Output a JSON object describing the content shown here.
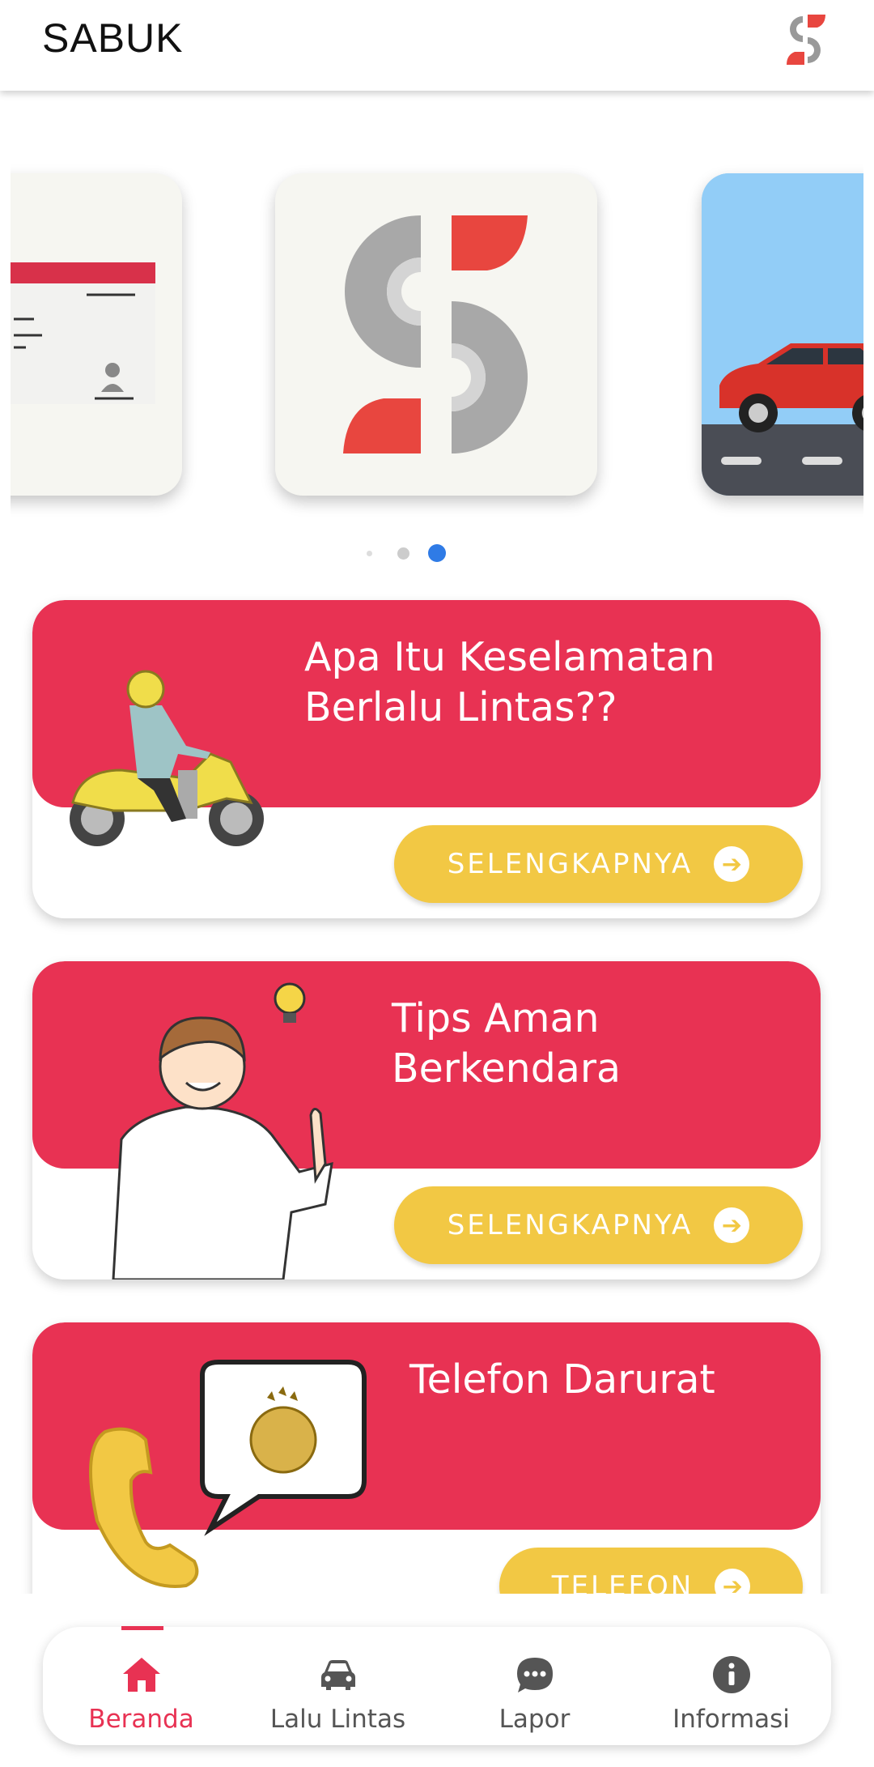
{
  "app": {
    "title": "SABUK"
  },
  "carousel": {
    "slides": [
      "license-card",
      "sabuk-logo",
      "red-car-on-road"
    ],
    "active_index": 2,
    "dot_count": 3
  },
  "cards": [
    {
      "heading_line1": "Apa Itu Keselamatan",
      "heading_line2": "Berlalu Lintas??",
      "button": "SELENGKAPNYA",
      "illustration": "motorcycle-rider"
    },
    {
      "heading_line1": "Tips Aman",
      "heading_line2": "Berkendara",
      "button": "SELENGKAPNYA",
      "illustration": "man-with-idea"
    },
    {
      "heading_line1": "Telefon Darurat",
      "heading_line2": "",
      "button": "TELEFON",
      "illustration": "phone-police-badge"
    }
  ],
  "nav": {
    "items": [
      {
        "label": "Beranda",
        "icon": "home-icon",
        "active": true
      },
      {
        "label": "Lalu Lintas",
        "icon": "car-icon",
        "active": false
      },
      {
        "label": "Lapor",
        "icon": "chat-icon",
        "active": false
      },
      {
        "label": "Informasi",
        "icon": "info-icon",
        "active": false
      }
    ]
  },
  "colors": {
    "accent": "#e83253",
    "button": "#f2c844",
    "active_dot": "#2f7be6"
  }
}
